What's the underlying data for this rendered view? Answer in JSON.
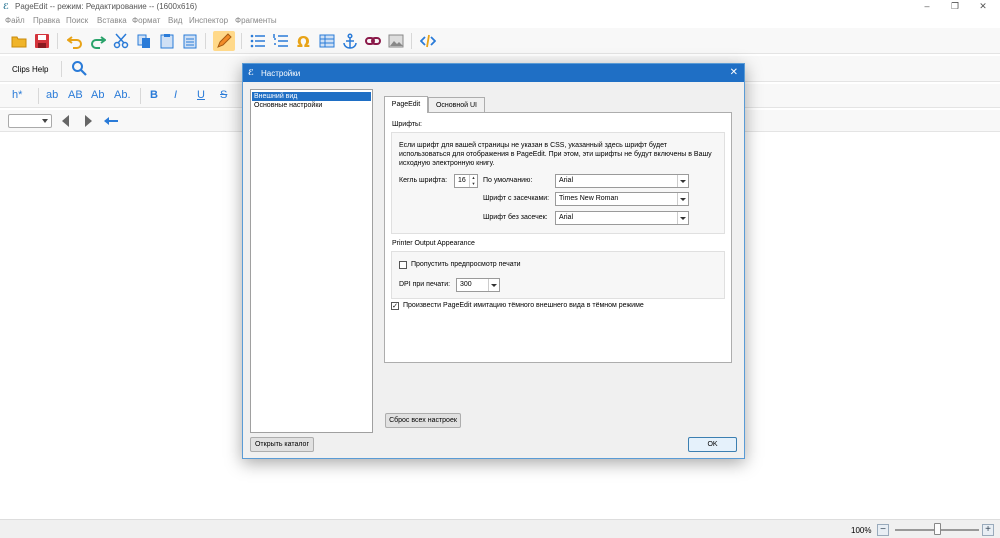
{
  "window": {
    "title": "PageEdit -- режим: Редактирование -- (1600x616)",
    "logo": "ℰ"
  },
  "menu": [
    "Файл",
    "Правка",
    "Поиск",
    "Вставка",
    "Формат",
    "Вид",
    "Инспектор",
    "Фрагменты"
  ],
  "toolbar": {
    "icons": [
      "open-folder",
      "save",
      "undo",
      "redo",
      "cut",
      "copy",
      "paste",
      "paste-special",
      "edit-pencil",
      "bullet-list",
      "numbered-list",
      "omega-special-char",
      "insert-table",
      "anchor",
      "link",
      "image",
      "code-view"
    ]
  },
  "clips_toolbar": {
    "label": "Clips Help"
  },
  "format_toolbar": {
    "heading": "h*",
    "buttons": [
      "ab",
      "AB",
      "Ab",
      "Ab.",
      "B",
      "I",
      "U",
      "S"
    ]
  },
  "statusbar": {
    "zoom": "100%",
    "zoom_minus": "−",
    "zoom_plus": "+",
    "zoom_level": 0.5
  },
  "dialog": {
    "title": "Настройки",
    "list_items": [
      "Внешний вид",
      "Основные настройки"
    ],
    "selected_index": 0,
    "open_catalog_button": "Открыть каталог",
    "reset_button": "Сброс всех настроек",
    "ok_button": "OK",
    "tabs": [
      "PageEdit",
      "Основной UI"
    ],
    "fonts": {
      "section": "Шрифты:",
      "description": "Если шрифт для вашей страницы не указан в CSS, указанный здесь шрифт будет использоваться для отображения в PageEdit. При этом, эти шрифты не будут включены в Вашу исходную электронную книгу.",
      "size_label": "Кегль шрифта:",
      "size_value": "16",
      "default_label": "По умолчанию:",
      "default_value": "Arial",
      "serif_label": "Шрифт с засечками:",
      "serif_value": "Times New Roman",
      "sans_label": "Шрифт без засечек:",
      "sans_value": "Arial"
    },
    "printer": {
      "section": "Printer Output Appearance",
      "skip_preview_label": "Пропустить предпросмотр печати",
      "skip_preview_checked": false,
      "dpi_label": "DPI при печати:",
      "dpi_value": "300"
    },
    "dark_mode": {
      "label": "Произвести PageEdit имитацию тёмного внешнего вида в тёмном режиме",
      "checked": true,
      "check_mark": "✓"
    }
  }
}
